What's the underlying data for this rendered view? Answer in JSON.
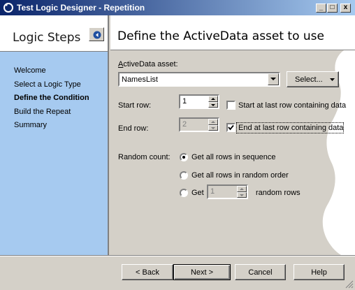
{
  "window": {
    "title": "Test Logic Designer - Repetition",
    "minimize_glyph": "_",
    "maximize_glyph": "□",
    "close_glyph": "x"
  },
  "sidebar": {
    "title": "Logic Steps",
    "collapse_icon": "chevron-left-icon",
    "steps": [
      {
        "label": "Welcome",
        "current": false
      },
      {
        "label": "Select a Logic Type",
        "current": false
      },
      {
        "label": "Define the Condition",
        "current": true
      },
      {
        "label": "Build the Repeat",
        "current": false
      },
      {
        "label": "Summary",
        "current": false
      }
    ]
  },
  "main": {
    "title": "Define the ActiveData asset to use",
    "asset": {
      "label": "ActiveData asset:",
      "value": "NamesList",
      "select_button": "Select..."
    },
    "start_row": {
      "label": "Start row:",
      "value": "1",
      "checkbox_label": "Start at last row containing data",
      "checked": false
    },
    "end_row": {
      "label": "End row:",
      "value": "2",
      "disabled": true,
      "checkbox_label": "End at last row containing data",
      "checked": true
    },
    "random": {
      "label": "Random count:",
      "options": [
        {
          "label": "Get all rows in sequence",
          "selected": true
        },
        {
          "label": "Get all rows in random order",
          "selected": false
        },
        {
          "label": "Get",
          "selected": false
        }
      ],
      "get_count_value": "1",
      "get_suffix": "random rows"
    }
  },
  "footer": {
    "back": "< Back",
    "next": "Next >",
    "cancel": "Cancel",
    "help": "Help"
  },
  "colors": {
    "sidebar_bg": "#a6caf0",
    "titlebar_start": "#0a246a",
    "face": "#d4d0c8"
  }
}
